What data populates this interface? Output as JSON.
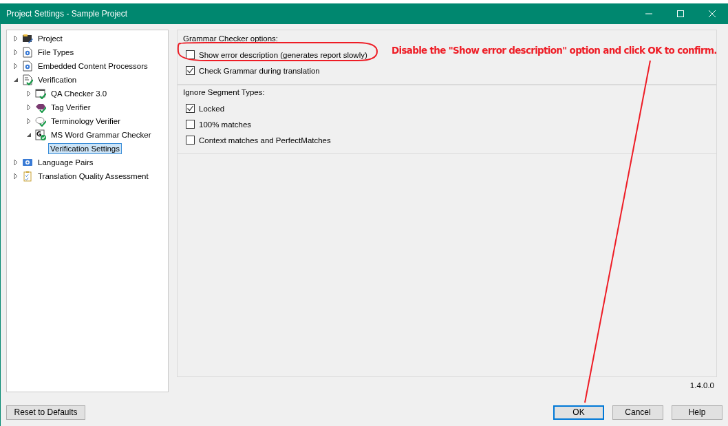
{
  "window": {
    "title": "Project Settings - Sample Project"
  },
  "tree": [
    {
      "label": "Project",
      "kind": "folder",
      "expanded": false,
      "selected": false
    },
    {
      "label": "File Types",
      "kind": "filetype",
      "expanded": false,
      "selected": false
    },
    {
      "label": "Embedded Content Processors",
      "kind": "filetype",
      "expanded": false,
      "selected": false
    },
    {
      "label": "Verification",
      "kind": "verification",
      "expanded": true,
      "selected": false,
      "children": [
        {
          "label": "QA Checker 3.0",
          "kind": "qa",
          "expanded": false,
          "selected": false
        },
        {
          "label": "Tag Verifier",
          "kind": "tag",
          "expanded": false,
          "selected": false
        },
        {
          "label": "Terminology Verifier",
          "kind": "terminology",
          "expanded": false,
          "selected": false
        },
        {
          "label": "MS Word Grammar Checker",
          "kind": "grammar",
          "expanded": true,
          "selected": false,
          "children": [
            {
              "label": "Verification Settings",
              "selected": true
            }
          ]
        }
      ]
    },
    {
      "label": "Language Pairs",
      "kind": "languages",
      "expanded": false,
      "selected": false
    },
    {
      "label": "Translation Quality Assessment",
      "kind": "assessment",
      "expanded": false,
      "selected": false
    }
  ],
  "groups": [
    {
      "title": "Grammar Checker options:",
      "options": [
        {
          "label": "Show error description (generates report slowly)",
          "checked": false
        },
        {
          "label": "Check Grammar during translation",
          "checked": true
        }
      ]
    },
    {
      "title": "Ignore Segment Types:",
      "options": [
        {
          "label": "Locked",
          "checked": true
        },
        {
          "label": "100% matches",
          "checked": false
        },
        {
          "label": "Context matches and PerfectMatches",
          "checked": false
        }
      ]
    }
  ],
  "annotation": "Disable the \"Show error description\" option and click OK to confirm.",
  "version": "1.4.0.0",
  "buttons": [
    {
      "label": "Reset to Defaults",
      "default": false
    },
    {
      "label": "OK",
      "default": true
    },
    {
      "label": "Cancel",
      "default": false
    },
    {
      "label": "Help",
      "default": false
    }
  ]
}
